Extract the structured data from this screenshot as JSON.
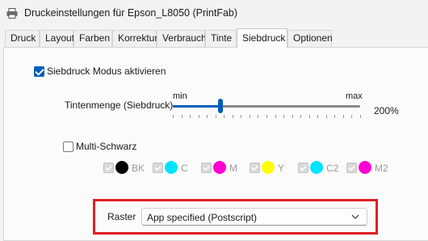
{
  "window": {
    "title": "Druckeinstellungen für Epson_L8050 (PrintFab)",
    "icon": "printer-icon"
  },
  "tabs": [
    {
      "label": "Druck",
      "active": false
    },
    {
      "label": "Layout",
      "active": false
    },
    {
      "label": "Farben",
      "active": false
    },
    {
      "label": "Korrektur",
      "active": false
    },
    {
      "label": "Verbrauch",
      "active": false
    },
    {
      "label": "Tinte",
      "active": false
    },
    {
      "label": "Siebdruck",
      "active": true
    },
    {
      "label": "Optionen",
      "active": false
    }
  ],
  "siebdruck": {
    "enable_label": "Siebdruck Modus aktivieren",
    "enable_checked": true,
    "ink_label": "Tintenmenge (Siebdruck)",
    "slider_min_label": "min",
    "slider_max_label": "max",
    "slider_fraction": 0.5,
    "slider_value_text": "200%",
    "multi_black_label": "Multi-Schwarz",
    "multi_black_checked": false,
    "inks": [
      {
        "label": "BK",
        "color": "#000000",
        "checked": true
      },
      {
        "label": "C",
        "color": "#00e5ff",
        "checked": true
      },
      {
        "label": "M",
        "color": "#ff00d4",
        "checked": true
      },
      {
        "label": "Y",
        "color": "#ffff00",
        "checked": true
      },
      {
        "label": "C2",
        "color": "#00e5ff",
        "checked": true
      },
      {
        "label": "M2",
        "color": "#ff00d4",
        "checked": true
      }
    ],
    "raster_label": "Raster",
    "raster_value": "App specified (Postscript)",
    "highlight_color": "#e01f26",
    "accent_color": "#005fb8"
  }
}
